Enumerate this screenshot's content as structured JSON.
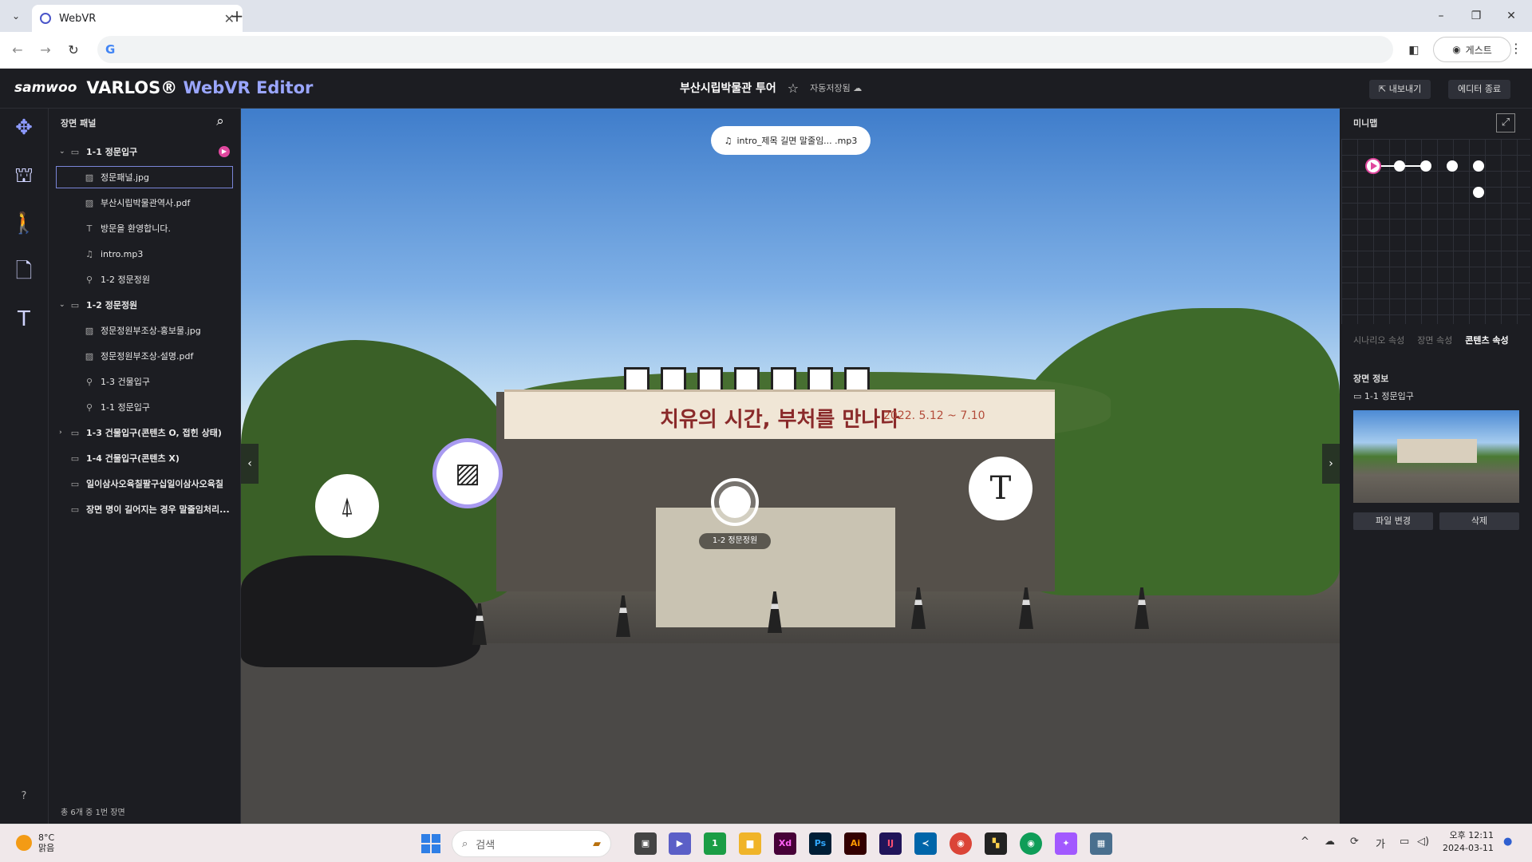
{
  "browser": {
    "tab_title": "WebVR",
    "tab_close": "✕",
    "new_tab": "+",
    "tab_list": "⌄",
    "back": "←",
    "forward": "→",
    "reload": "↻",
    "omnibox_value": "",
    "guest_label": "게스트",
    "minimize": "–",
    "restore": "❐",
    "close": "✕"
  },
  "header": {
    "logo": "samwoo",
    "product": "VARLOS®",
    "product_editor": "WebVR Editor",
    "project_name": "부산시립박물관 투어",
    "autosave": "자동저장됨",
    "export": "내보내기",
    "exit_editor": "에디터 종료"
  },
  "tools": [
    {
      "name": "move-tool",
      "glyph": "✥"
    },
    {
      "name": "scene-tool",
      "glyph": "⛫"
    },
    {
      "name": "walk-tool",
      "glyph": "🚶"
    },
    {
      "name": "note-tool",
      "glyph": "🗋"
    },
    {
      "name": "text-tool",
      "glyph": "T"
    }
  ],
  "help": "?",
  "scene_panel": {
    "title": "장면 패널",
    "footer": "총 6개 중 1번 장면",
    "items": [
      {
        "label": "1-1 정문입구",
        "icon": "▭",
        "level": 0,
        "expanded": true,
        "playing": true
      },
      {
        "label": "정문패널.jpg",
        "icon": "▨",
        "level": 1,
        "selected": true
      },
      {
        "label": "부산시립박물관역사.pdf",
        "icon": "▨",
        "level": 1
      },
      {
        "label": "방문을 환영합니다.",
        "icon": "T",
        "level": 1
      },
      {
        "label": "intro.mp3",
        "icon": "♫",
        "level": 1
      },
      {
        "label": "1-2 정문정원",
        "icon": "⚲",
        "level": 1
      },
      {
        "label": "1-2 정문정원",
        "icon": "▭",
        "level": 0,
        "expanded": true
      },
      {
        "label": "정문정원부조상-홍보물.jpg",
        "icon": "▨",
        "level": 1
      },
      {
        "label": "정문정원부조상-설명.pdf",
        "icon": "▨",
        "level": 1
      },
      {
        "label": "1-3 건물입구",
        "icon": "⚲",
        "level": 1
      },
      {
        "label": "1-1 정문입구",
        "icon": "⚲",
        "level": 1
      },
      {
        "label": "1-3 건물입구(콘텐츠 O, 접힌 상태)",
        "icon": "▭",
        "level": 0,
        "expanded": false
      },
      {
        "label": "1-4 건물입구(콘텐츠 X)",
        "icon": "▭",
        "level": 0
      },
      {
        "label": "일이삼사오육칠팔구십일이삼사오육칠",
        "icon": "▭",
        "level": 0
      },
      {
        "label": "장면 명이 길어지는 경우 말줄임처리...",
        "icon": "▭",
        "level": 0
      }
    ]
  },
  "viewport": {
    "audio_chip": "intro_제목 길면 말줄임... .mp3",
    "banner_main": "치유의 시간, 부처를 만나다",
    "banner_date": "2022. 5.12 ~ 7.10",
    "hotspot_move_label": "1-2 정문정원",
    "hotspot_text_glyph": "T",
    "hotspot_pdf_glyph": "⍋",
    "hotspot_image_glyph": "▨",
    "arrow_left": "‹",
    "arrow_right": "›"
  },
  "right_panel": {
    "minimap_title": "미니맵",
    "expand_glyph": "⤢",
    "tabs": [
      {
        "label": "시나리오 속성",
        "active": false
      },
      {
        "label": "장면 속성",
        "active": false
      },
      {
        "label": "콘텐츠 속성",
        "active": true
      }
    ],
    "scene_info_title": "장면 정보",
    "scene_info_name": "1-1 정문입구",
    "change_file": "파일 변경",
    "delete": "삭제"
  },
  "taskbar": {
    "temp": "8°C",
    "weather": "맑음",
    "search_placeholder": "검색",
    "time": "오후 12:11",
    "date": "2024-03-11",
    "ime": "가",
    "chat_badge": "1"
  },
  "colors": {
    "accent": "#9aa6ff",
    "play": "#e0479e",
    "selection": "#7a85d8"
  }
}
